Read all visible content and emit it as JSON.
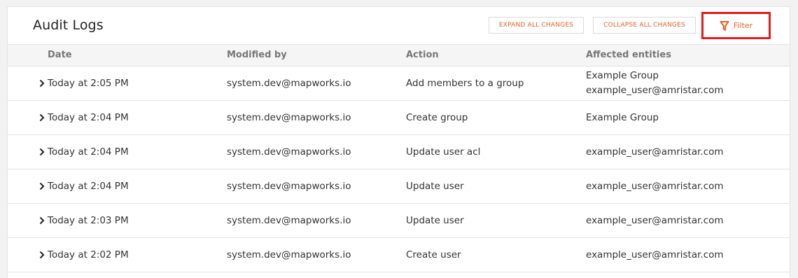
{
  "header": {
    "title": "Audit Logs",
    "expand_label": "EXPAND ALL CHANGES",
    "collapse_label": "COLLAPSE ALL CHANGES",
    "filter_label": "Filter"
  },
  "columns": [
    "Date",
    "Modified by",
    "Action",
    "Affected entities"
  ],
  "rows": [
    {
      "date": "Today at 2:05 PM",
      "modified_by": "system.dev@mapworks.io",
      "action": "Add members to a group",
      "entities": [
        "Example Group",
        "example_user@amristar.com"
      ]
    },
    {
      "date": "Today at 2:04 PM",
      "modified_by": "system.dev@mapworks.io",
      "action": "Create group",
      "entities": [
        "Example Group"
      ]
    },
    {
      "date": "Today at 2:04 PM",
      "modified_by": "system.dev@mapworks.io",
      "action": "Update user acl",
      "entities": [
        "example_user@amristar.com"
      ]
    },
    {
      "date": "Today at 2:04 PM",
      "modified_by": "system.dev@mapworks.io",
      "action": "Update user",
      "entities": [
        "example_user@amristar.com"
      ]
    },
    {
      "date": "Today at 2:03 PM",
      "modified_by": "system.dev@mapworks.io",
      "action": "Update user",
      "entities": [
        "example_user@amristar.com"
      ]
    },
    {
      "date": "Today at 2:02 PM",
      "modified_by": "system.dev@mapworks.io",
      "action": "Create user",
      "entities": [
        "example_user@amristar.com"
      ]
    }
  ],
  "colors": {
    "accent": "#e8612c",
    "highlight": "#e31b1b"
  },
  "icons": {
    "filter": "filter-funnel-icon",
    "expand_row": "chevron-right-icon"
  }
}
